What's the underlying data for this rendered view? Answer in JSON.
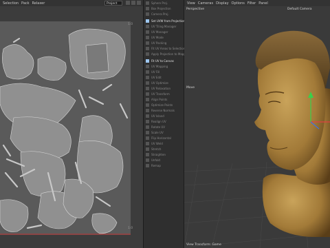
{
  "uv_menu": [
    "Selection",
    "Pack",
    "Relaxer"
  ],
  "uv_projection": "Project",
  "uv_corners": {
    "top_right": "1.0",
    "bottom_right": "1.0"
  },
  "viewport_menu": [
    "View",
    "Cameras",
    "Display",
    "Options",
    "Filter",
    "Panel"
  ],
  "viewport": {
    "camera_label": "Perspective",
    "default_camera": "Default Camera",
    "move_tool": "Move",
    "status": "View Transform: Game"
  },
  "tools": [
    {
      "label": "Sphere Proj.",
      "active": false
    },
    {
      "label": "Box Projection",
      "active": false
    },
    {
      "label": "Camera Proj.",
      "active": false
    },
    {
      "label": "Set UVW from Projection",
      "active": true
    },
    {
      "label": "UV Tiling Manager",
      "active": false
    },
    {
      "label": "UV Manager",
      "active": false
    },
    {
      "label": "UV Mode",
      "active": false
    },
    {
      "label": "UV Packing",
      "active": false
    },
    {
      "label": "Fit UV Areas to Selection",
      "active": false
    },
    {
      "label": "Apply Projection to Mapping",
      "active": false
    },
    {
      "label": "Fit UV to Canvas",
      "active": true
    },
    {
      "label": "UV Mapping",
      "active": false
    },
    {
      "label": "UV Fill",
      "active": false
    },
    {
      "label": "UV Edit",
      "active": false
    },
    {
      "label": "UV Optimize",
      "active": false
    },
    {
      "label": "UV Relaxation",
      "active": false
    },
    {
      "label": "UV Transform",
      "active": false
    },
    {
      "label": "Align Points",
      "active": false
    },
    {
      "label": "Optimize Points",
      "active": false
    },
    {
      "label": "Reverse Normals",
      "active": false
    },
    {
      "label": "UV Island",
      "active": false
    },
    {
      "label": "Realign UV",
      "active": false
    },
    {
      "label": "Rotate UV",
      "active": false
    },
    {
      "label": "Scale UV",
      "active": false
    },
    {
      "label": "Flip Horizontal",
      "active": false
    },
    {
      "label": "UV Weld",
      "active": false
    },
    {
      "label": "Stretch",
      "active": false
    },
    {
      "label": "Straighten",
      "active": false
    },
    {
      "label": "Unfold",
      "active": false
    },
    {
      "label": "Remap",
      "active": false
    }
  ],
  "colors": {
    "accent": "#9ec7f0",
    "bust": "#a27a38",
    "uv_bg": "#5a5a5a"
  }
}
